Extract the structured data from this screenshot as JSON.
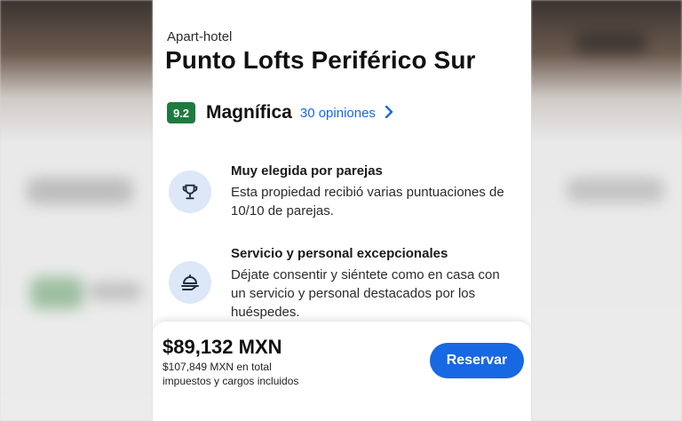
{
  "property": {
    "type": "Apart-hotel",
    "name": "Punto Lofts Periférico Sur"
  },
  "rating": {
    "score": "9.2",
    "label": "Magnífica",
    "reviews_link": "30 opiniones",
    "reviews_icon": "chevron-right-icon",
    "score_color": "#1f7a3f",
    "link_color": "#1668e3"
  },
  "highlights": [
    {
      "icon": "trophy-icon",
      "title": "Muy elegida por parejas",
      "lines": [
        "Esta propiedad recibió varias puntuaciones de",
        "10/10 de parejas."
      ]
    },
    {
      "icon": "service-bell-icon",
      "title": "Servicio y personal excepcionales",
      "lines": [
        "Déjate consentir y siéntete como en casa con",
        "un servicio y personal destacados por los",
        "huéspedes."
      ]
    }
  ],
  "booking": {
    "price": "$89,132 MXN",
    "total_line1": "$107,849 MXN en total",
    "total_line2": "impuestos y cargos incluidos",
    "reserve_label": "Reservar",
    "button_color": "#1668e3"
  }
}
